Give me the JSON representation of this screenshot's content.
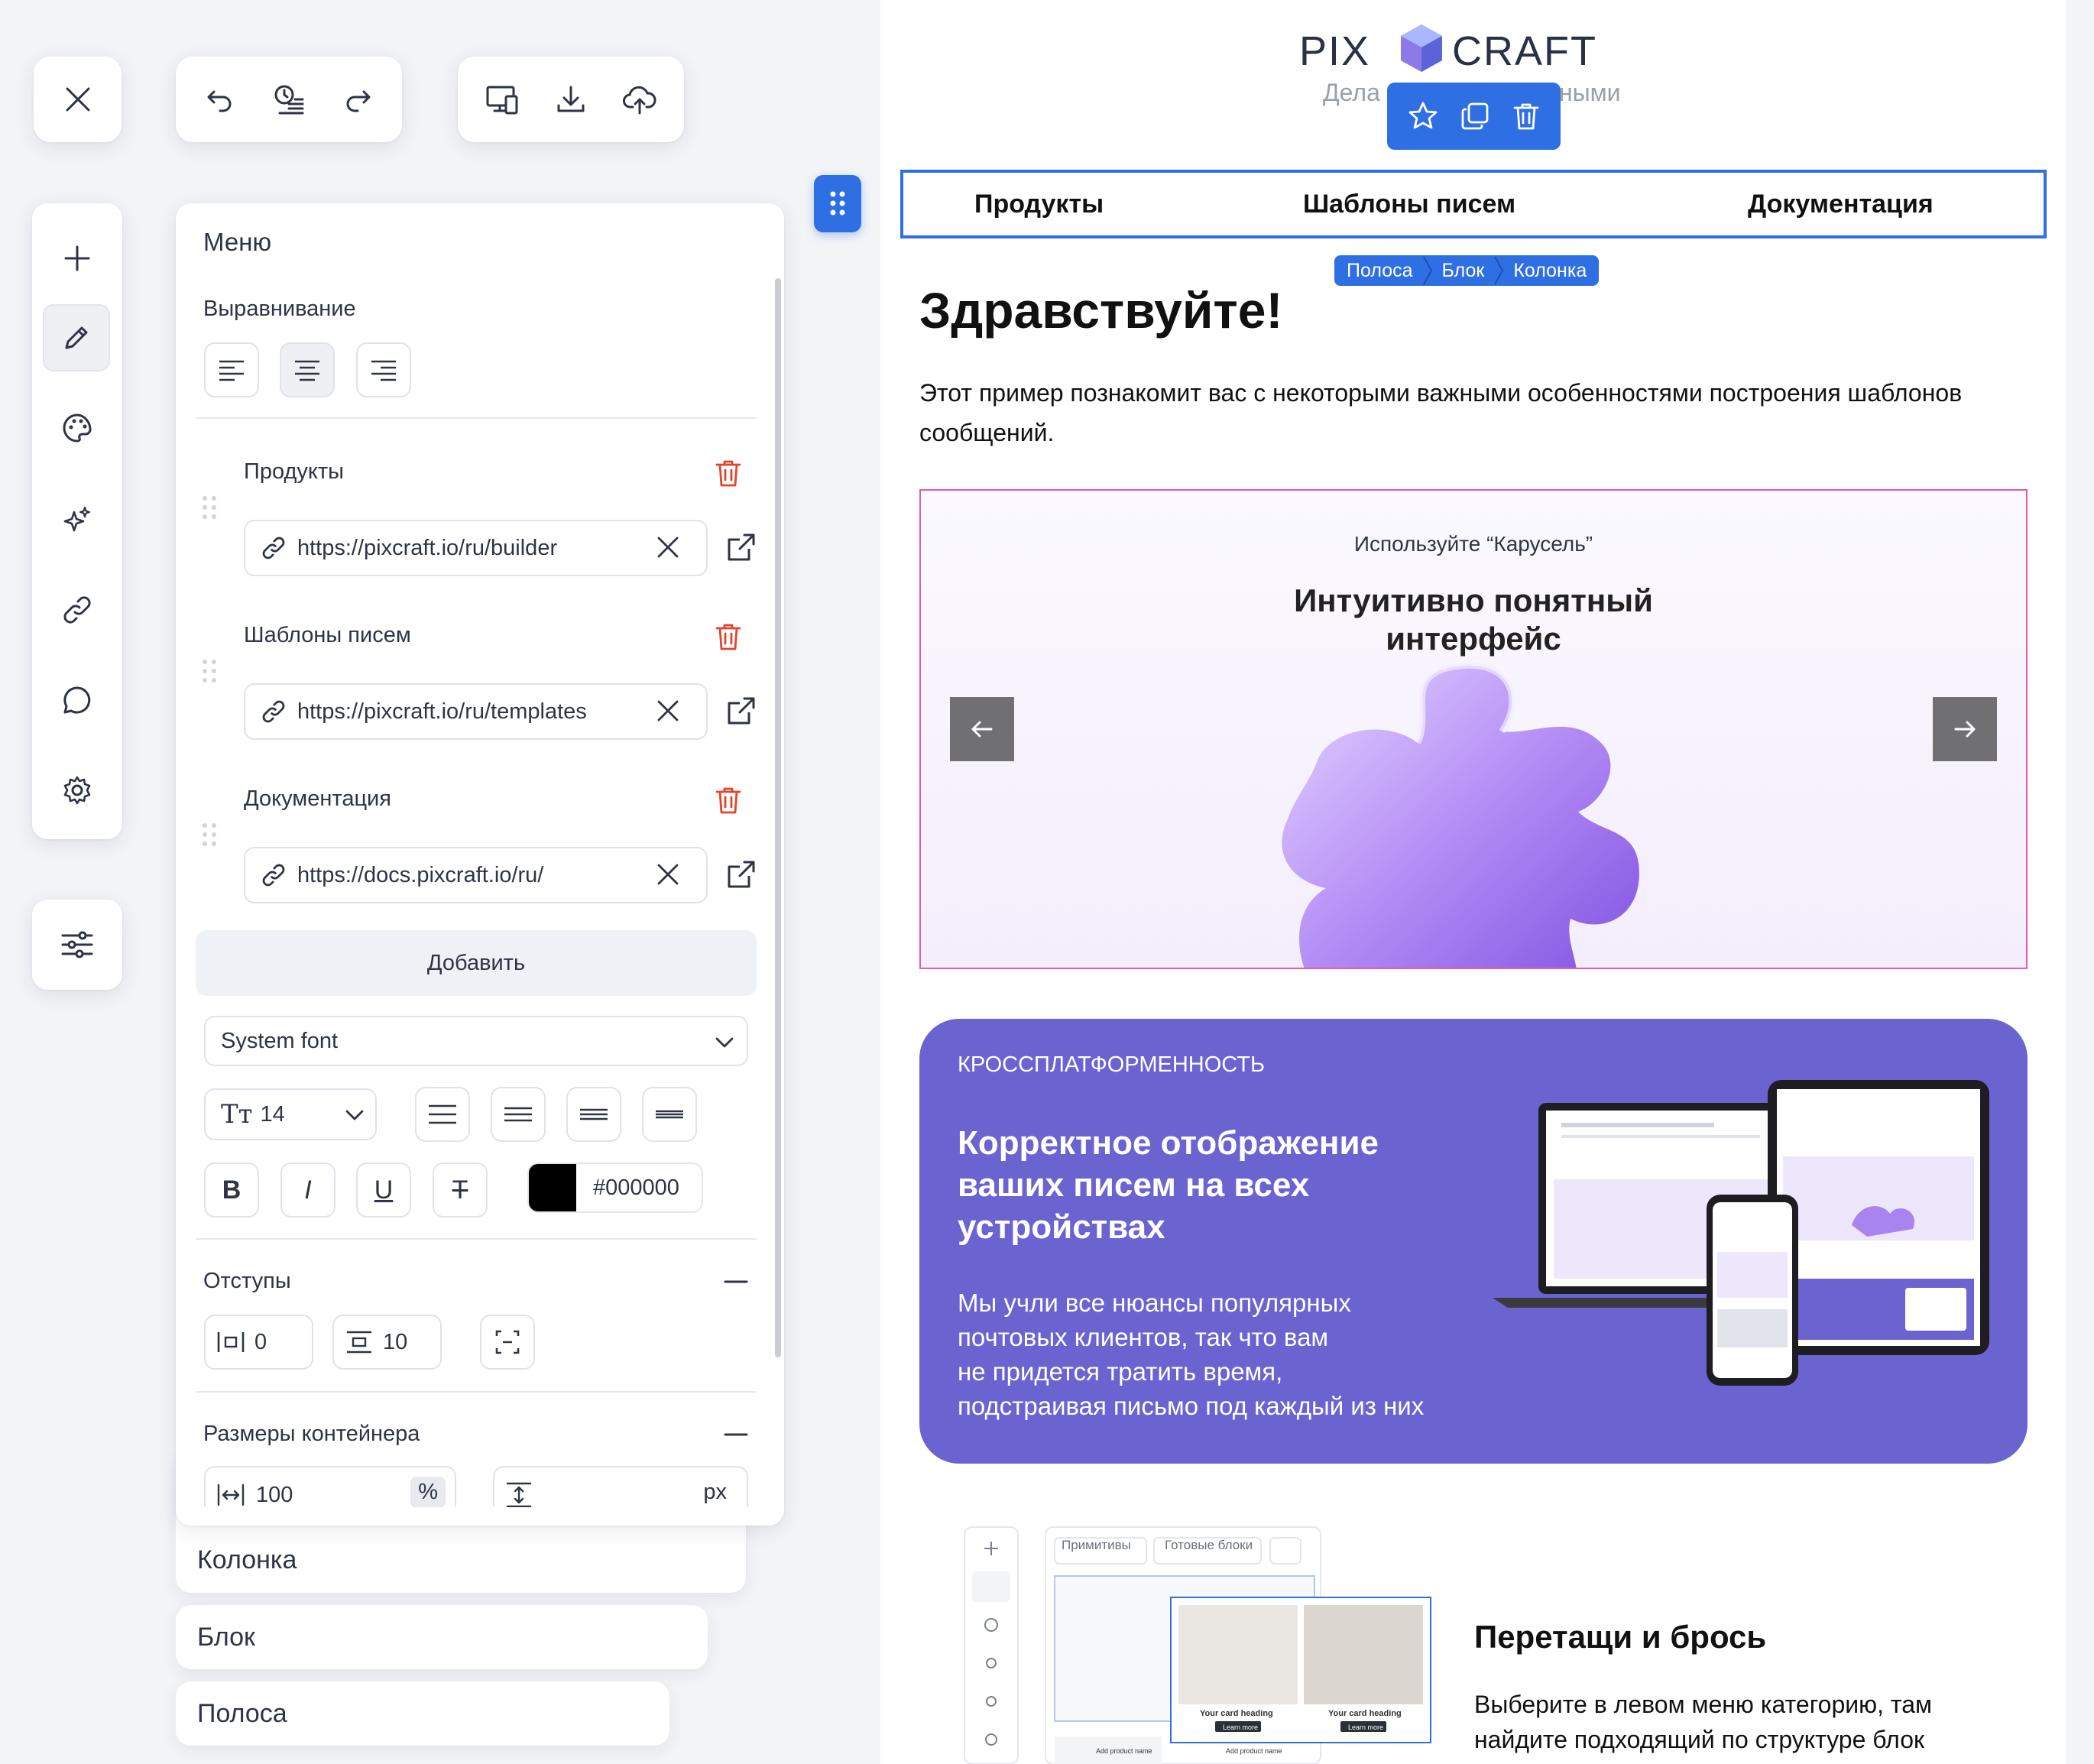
{
  "toolbar": {
    "close_icon": "close-icon",
    "history": [
      "undo-icon",
      "history-icon",
      "redo-icon"
    ],
    "export": [
      "preview-devices-icon",
      "download-icon",
      "upload-cloud-icon"
    ]
  },
  "sidebar_tools": [
    "plus-icon",
    "pencil-icon",
    "palette-icon",
    "sparkles-icon",
    "link-icon",
    "comment-icon",
    "gear-icon"
  ],
  "settings_icon": "sliders-icon",
  "panel": {
    "title": "Меню",
    "alignment_label": "Выравнивание",
    "items": [
      {
        "label": "Продукты",
        "url": "https://pixcraft.io/ru/builder"
      },
      {
        "label": "Шаблоны писем",
        "url": "https://pixcraft.io/ru/templates"
      },
      {
        "label": "Документация",
        "url": "https://docs.pixcraft.io/ru/"
      }
    ],
    "add_label": "Добавить",
    "font": "System font",
    "font_size": "14",
    "style_buttons": [
      "B",
      "I",
      "U",
      "T"
    ],
    "color_value": "#000000",
    "color_swatch": "#000000",
    "padding_label": "Отступы",
    "padding_h": "0",
    "padding_v": "10",
    "container_label": "Размеры контейнера",
    "width_value": "100",
    "width_unit": "%",
    "height_unit": "px"
  },
  "stack": [
    "Колонка",
    "Блок",
    "Полоса"
  ],
  "preview": {
    "logo_left": "PIX",
    "logo_right": "CRAFT",
    "tagline_left": "Дела",
    "tagline_right": "ными",
    "menu": [
      "Продукты",
      "Шаблоны писем",
      "Документация"
    ],
    "breadcrumb": [
      "Полоса",
      "Блок",
      "Колонка"
    ],
    "heading": "Здравствуйте!",
    "intro": "Этот пример познакомит вас с некоторыми важными особенностями построения шаблонов сообщений.",
    "carousel": {
      "caption": "Используйте “Карусель”",
      "title_line1": "Интуитивно понятный",
      "title_line2": "интерфейс"
    },
    "promo": {
      "kicker": "КРОССПЛАТФОРМЕННОСТЬ",
      "title_lines": [
        "Корректное отображение",
        "ваших писем на всех",
        "устройствах"
      ],
      "body_lines": [
        "Мы учли все нюансы популярных",
        "почтовых клиентов, так что вам",
        "не придется тратить время,",
        "подстраивая письмо под каждый из них"
      ]
    },
    "dnd": {
      "title": "Перетащи и брось",
      "body_line1": "Выберите в левом меню категорию, там",
      "body_line2": "найдите подходящий по структуре блок",
      "tabs": [
        "Примитивы",
        "Готовые блоки"
      ],
      "card_heading": "Your card heading",
      "card_button": "Learn more",
      "product_name": "Add product name"
    },
    "accent": "#2f6fe4",
    "promo_bg": "#6b63d0",
    "carousel_border": "#e75aa5"
  }
}
